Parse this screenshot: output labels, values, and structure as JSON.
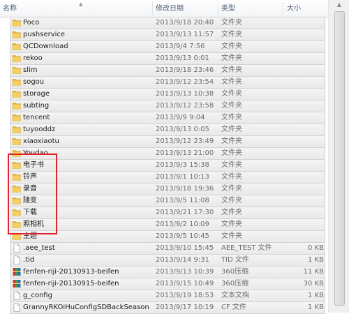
{
  "columns": {
    "name": "名称",
    "date": "修改日期",
    "type": "类型",
    "size": "大小"
  },
  "rows": [
    {
      "name": "Poco",
      "date": "2013/9/18 20:40",
      "type": "文件夹",
      "size": "",
      "icon": "folder-icon"
    },
    {
      "name": "pushservice",
      "date": "2013/9/13 11:57",
      "type": "文件夹",
      "size": "",
      "icon": "folder-icon"
    },
    {
      "name": "QCDownload",
      "date": "2013/9/4 7:56",
      "type": "文件夹",
      "size": "",
      "icon": "folder-icon"
    },
    {
      "name": "rekoo",
      "date": "2013/9/13 0:01",
      "type": "文件夹",
      "size": "",
      "icon": "folder-icon"
    },
    {
      "name": "slim",
      "date": "2013/9/18 23:46",
      "type": "文件夹",
      "size": "",
      "icon": "folder-icon"
    },
    {
      "name": "sogou",
      "date": "2013/9/12 23:54",
      "type": "文件夹",
      "size": "",
      "icon": "folder-icon"
    },
    {
      "name": "storage",
      "date": "2013/9/13 10:38",
      "type": "文件夹",
      "size": "",
      "icon": "folder-icon"
    },
    {
      "name": "subting",
      "date": "2013/9/12 23:58",
      "type": "文件夹",
      "size": "",
      "icon": "folder-icon"
    },
    {
      "name": "tencent",
      "date": "2013/9/9 9:04",
      "type": "文件夹",
      "size": "",
      "icon": "folder-icon"
    },
    {
      "name": "tuyooddz",
      "date": "2013/9/13 0:05",
      "type": "文件夹",
      "size": "",
      "icon": "folder-icon"
    },
    {
      "name": "xiaoxiaotu",
      "date": "2013/9/12 23:49",
      "type": "文件夹",
      "size": "",
      "icon": "folder-icon"
    },
    {
      "name": "Youdao",
      "date": "2013/9/13 21:00",
      "type": "文件夹",
      "size": "",
      "icon": "folder-icon"
    },
    {
      "name": "电子书",
      "date": "2013/9/3 15:38",
      "type": "文件夹",
      "size": "",
      "icon": "folder-icon"
    },
    {
      "name": "铃声",
      "date": "2013/9/1 10:13",
      "type": "文件夹",
      "size": "",
      "icon": "folder-icon"
    },
    {
      "name": "录音",
      "date": "2013/9/18 19:36",
      "type": "文件夹",
      "size": "",
      "icon": "folder-icon"
    },
    {
      "name": "随变",
      "date": "2013/9/5 11:08",
      "type": "文件夹",
      "size": "",
      "icon": "folder-icon"
    },
    {
      "name": "下载",
      "date": "2013/9/21 17:30",
      "type": "文件夹",
      "size": "",
      "icon": "folder-icon"
    },
    {
      "name": "照相机",
      "date": "2013/9/2 10:09",
      "type": "文件夹",
      "size": "",
      "icon": "folder-icon"
    },
    {
      "name": "主题",
      "date": "2013/9/5 10:45",
      "type": "文件夹",
      "size": "",
      "icon": "folder-icon"
    },
    {
      "name": ".aee_test",
      "date": "2013/9/10 15:45",
      "type": "AEE_TEST 文件",
      "size": "0 KB",
      "icon": "file-icon"
    },
    {
      "name": ".tid",
      "date": "2013/9/14 9:31",
      "type": "TID 文件",
      "size": "1 KB",
      "icon": "file-icon"
    },
    {
      "name": "fenfen-riji-20130913-beifen",
      "date": "2013/9/13 10:39",
      "type": "360压缩",
      "size": "11 KB",
      "icon": "archive-icon"
    },
    {
      "name": "fenfen-riji-20130915-beifen",
      "date": "2013/9/15 10:49",
      "type": "360压缩",
      "size": "30 KB",
      "icon": "archive-icon"
    },
    {
      "name": "g_config",
      "date": "2013/9/19 18:53",
      "type": "文本文档",
      "size": "1 KB",
      "icon": "file-icon"
    },
    {
      "name": "GrannyRKOiHuConfigSDBackSeason...",
      "date": "2013/9/17 10:19",
      "type": "CF 文件",
      "size": "1 KB",
      "icon": "file-icon"
    }
  ],
  "selected_rows": [
    0,
    1,
    2,
    3,
    4,
    5,
    6,
    7,
    8,
    9,
    10,
    11,
    12,
    13,
    14,
    15,
    16,
    17,
    18,
    19,
    20,
    21,
    22,
    23,
    24
  ],
  "colors": {
    "selection_border": "#d3d3d3",
    "highlight_box": "#e0202a",
    "folder": "#f0c14b"
  }
}
